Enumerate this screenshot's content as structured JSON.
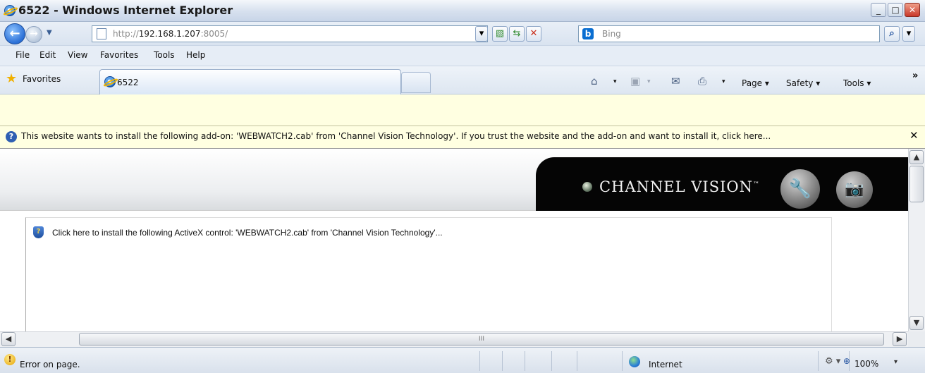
{
  "window": {
    "title": "6522 - Windows Internet Explorer",
    "minimize_glyph": "_",
    "maximize_glyph": "□",
    "close_glyph": "✕"
  },
  "navigation": {
    "back_glyph": "←",
    "forward_glyph": "→",
    "recent_glyph": "▼",
    "address_prefix": "http://",
    "address_host": "192.168.1.207",
    "address_port": ":8005/",
    "search_placeholder": "Bing",
    "search_button_glyph": "⌕",
    "search_options_glyph": "▾"
  },
  "menubar": {
    "items": [
      "File",
      "Edit",
      "View",
      "Favorites",
      "Tools",
      "Help"
    ]
  },
  "favorites_bar": {
    "favorites_label": "Favorites",
    "tab_label": "6522",
    "chevron": "»"
  },
  "command_bar": {
    "page_label": "Page ▾",
    "safety_label": "Safety ▾",
    "tools_label": "Tools ▾",
    "home_glyph": "⌂",
    "feeds_glyph": "▣",
    "mail_glyph": "✉",
    "print_glyph": "⎙",
    "caret": "▾"
  },
  "infobar": {
    "message": "This website wants to install the following add-on: 'WEBWATCH2.cab' from 'Channel Vision Technology'. If you trust the website and the add-on and want to install it, click here...",
    "close_glyph": "✕",
    "icon_glyph": "?"
  },
  "page": {
    "brand": "CHANNEL VISION",
    "brand_tm": "™",
    "tools_glyph": "🔧",
    "camera_glyph": "📷",
    "activex_message": "Click here to install the following ActiveX control: 'WEBWATCH2.cab' from 'Channel Vision Technology'...",
    "shield_glyph": "?"
  },
  "scrollbars": {
    "up_glyph": "▲",
    "down_glyph": "▼",
    "left_glyph": "◀",
    "right_glyph": "▶",
    "hthumb_grip": "III"
  },
  "statusbar": {
    "error_text": "Error on page.",
    "warn_glyph": "!",
    "zone": "Internet",
    "zoom": "100%",
    "zoom_caret": "▾",
    "protect_glyph": "⚙ ▾"
  },
  "colors": {
    "infobar_bg": "#ffffe1",
    "banner_dark": "#050505",
    "accent_blue": "#2a6fd6"
  }
}
